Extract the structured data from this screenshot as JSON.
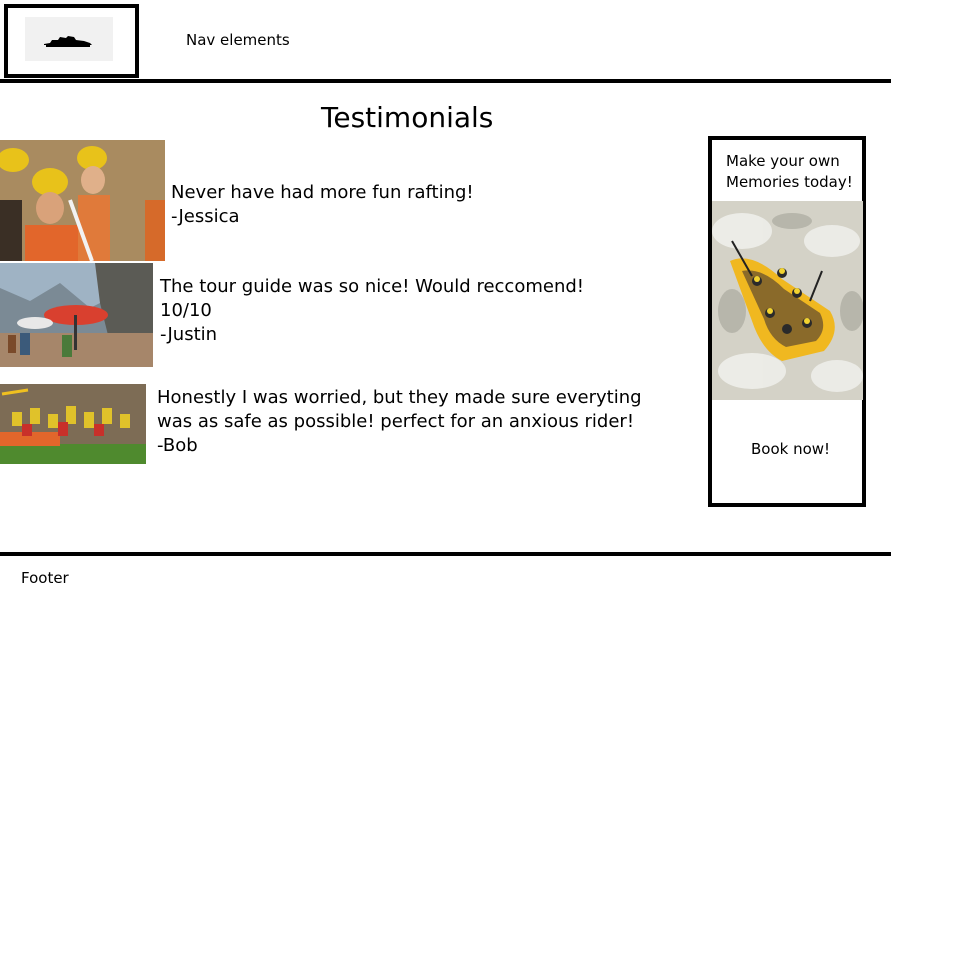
{
  "header": {
    "nav_label": "Nav elements"
  },
  "main": {
    "title": "Testimonials",
    "testimonials": [
      {
        "quote": "Never have had more fun rafting!",
        "author": "-Jessica"
      },
      {
        "quote": "The tour guide was so nice! Would reccomend!",
        "rating": "10/10",
        "author": "-Justin"
      },
      {
        "quote_line1": "Honestly I was worried, but they made sure everyting",
        "quote_line2": "was as safe as possible! perfect for an anxious rider!",
        "author": "-Bob"
      }
    ]
  },
  "ad": {
    "title": "Make your own Memories today!",
    "cta": "Book now!"
  },
  "footer": {
    "label": "Footer"
  },
  "icons": {
    "logo": "logo-icon",
    "photo_1": "rafters-with-helmets-photo",
    "photo_2": "riverside-umbrella-photo",
    "photo_3": "rafting-group-photo",
    "ad_photo": "whitewater-raft-photo"
  },
  "colors": {
    "line": "#000000",
    "background": "#ffffff"
  }
}
